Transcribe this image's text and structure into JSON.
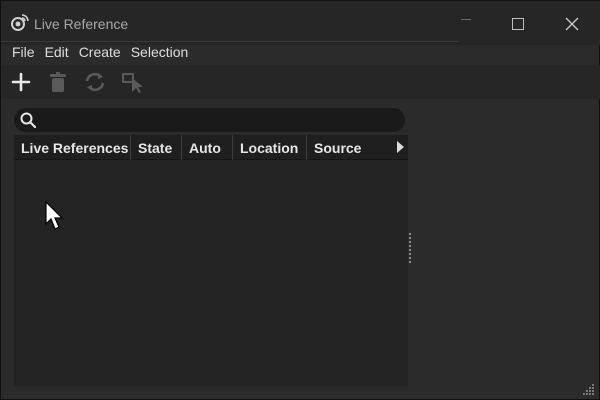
{
  "window": {
    "title": "Live Reference",
    "app_icon": "live-reference-icon"
  },
  "menu": {
    "items": [
      "File",
      "Edit",
      "Create",
      "Selection"
    ]
  },
  "toolbar": {
    "tools": [
      {
        "name": "add-icon",
        "enabled": true
      },
      {
        "name": "trash-icon",
        "enabled": false
      },
      {
        "name": "refresh-icon",
        "enabled": false
      },
      {
        "name": "pick-reference-icon",
        "enabled": false
      }
    ]
  },
  "search": {
    "value": "",
    "placeholder": ""
  },
  "table": {
    "columns": [
      "Live References",
      "State",
      "Auto",
      "Location",
      "Source"
    ],
    "rows": []
  },
  "colors": {
    "window_bg": "#2b2b2b",
    "titlebar_bg": "#262626",
    "table_bg": "#232323",
    "text": "#dcdcdc"
  }
}
